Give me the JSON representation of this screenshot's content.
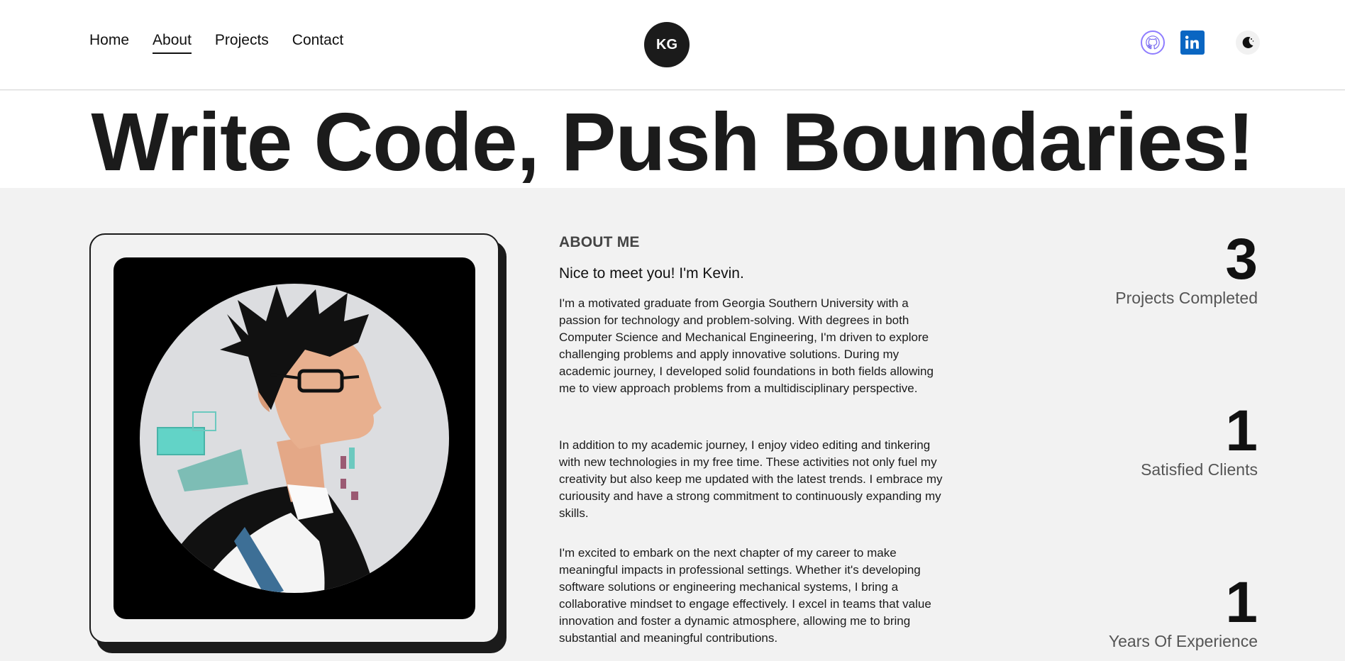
{
  "nav": {
    "items": [
      {
        "label": "Home",
        "active": false
      },
      {
        "label": "About",
        "active": true
      },
      {
        "label": "Projects",
        "active": false
      },
      {
        "label": "Contact",
        "active": false
      }
    ]
  },
  "logo": {
    "initials": "KG"
  },
  "header_icons": [
    "github-icon",
    "linkedin-icon",
    "moon-icon"
  ],
  "hero": {
    "title": "Write Code, Push Boundaries!"
  },
  "about": {
    "label": "ABOUT ME",
    "greeting": "Nice to meet you! I'm Kevin.",
    "paragraphs": [
      "I'm a motivated graduate from Georgia Southern University with a passion for technology and problem-solving. With degrees in both Computer Science and Mechanical Engineering, I'm driven to explore challenging problems and apply innovative solutions. During my academic journey, I developed solid foundations in both fields allowing me to view approach problems from a multidisciplinary perspective.",
      "In addition to my academic journey, I enjoy video editing and tinkering with new technologies in my free time. These activities not only fuel my creativity but also keep me updated with the latest trends. I embrace my curiousity and have a strong commitment to continuously expanding my skills.",
      "I'm excited to embark on the next chapter of my career to make meaningful impacts in professional settings. Whether it's developing software solutions or engineering mechanical systems, I bring a collaborative mindset to engage effectively. I excel in teams that value innovation and foster a dynamic atmosphere, allowing me to bring substantial and meaningful contributions."
    ]
  },
  "stats": [
    {
      "value": "3",
      "label": "Projects Completed"
    },
    {
      "value": "1",
      "label": "Satisfied Clients"
    },
    {
      "value": "1",
      "label": "Years Of Experience"
    }
  ],
  "colors": {
    "dark": "#1b1b1b",
    "background": "#f2f2f2",
    "linkedin": "#0a66c2",
    "github_ring": "#8f7dff"
  }
}
